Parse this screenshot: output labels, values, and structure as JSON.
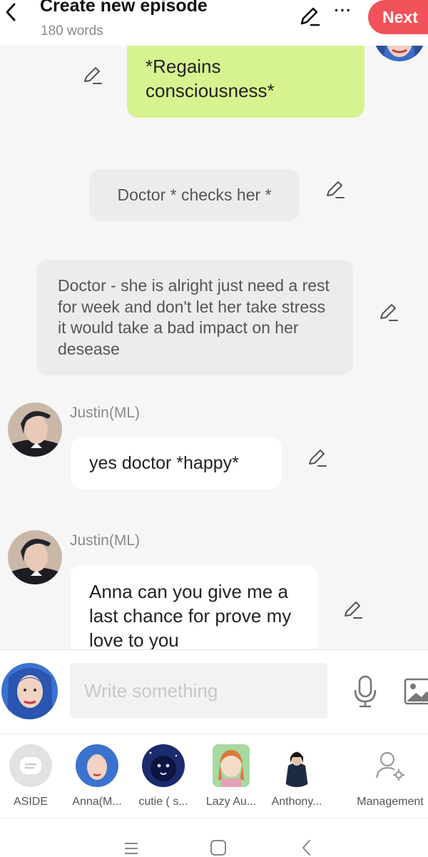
{
  "header": {
    "title": "Create new episode",
    "word_count": "180 words",
    "next_label": "Next"
  },
  "messages": [
    {
      "type": "narration-right",
      "text": "*Regains consciousness*",
      "color": "#d7f38f"
    },
    {
      "type": "narration-center",
      "text": "Doctor * checks her *"
    },
    {
      "type": "narration-left",
      "text": "Doctor - she is alright just need a rest for week and don't let her take stress it would take a bad impact on her desease"
    },
    {
      "type": "speech",
      "speaker": "Justin(ML)",
      "text": "yes doctor *happy*"
    },
    {
      "type": "speech",
      "speaker": "Justin(ML)",
      "text": "Anna can you give me a last chance for prove my love to you"
    }
  ],
  "input": {
    "placeholder": "Write something"
  },
  "characters": [
    {
      "label": "ASIDE",
      "icon": "aside-icon"
    },
    {
      "label": "Anna(M...",
      "icon": "avatar-anna"
    },
    {
      "label": "cutie ( s...",
      "icon": "avatar-cutie"
    },
    {
      "label": "Lazy Au...",
      "icon": "avatar-lazy"
    },
    {
      "label": "Anthony...",
      "icon": "avatar-anthony"
    },
    {
      "label": "Management",
      "icon": "management-icon"
    }
  ],
  "colors": {
    "accent": "#f2525a",
    "narration_green": "#d7f38f",
    "bubble_gray": "#ececec"
  }
}
